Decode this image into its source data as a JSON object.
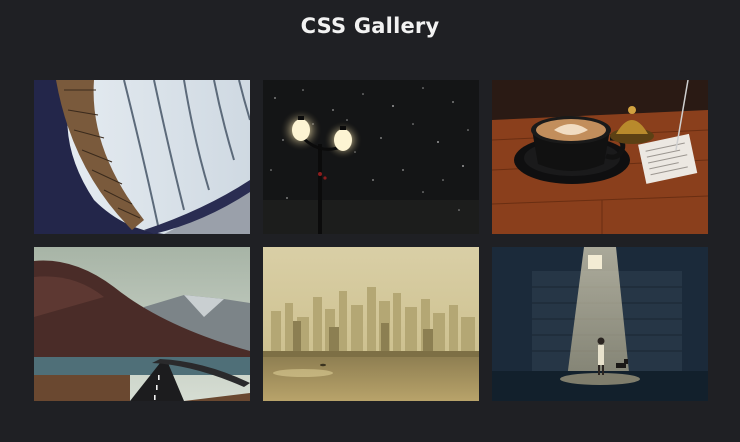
{
  "page": {
    "title": "CSS Gallery"
  },
  "gallery": {
    "images": [
      {
        "subject": "library-architecture"
      },
      {
        "subject": "streetlamp-in-snow"
      },
      {
        "subject": "latte-coffee-cup"
      },
      {
        "subject": "mountain-road-landscape"
      },
      {
        "subject": "hazy-city-skyline"
      },
      {
        "subject": "person-in-light-beam"
      }
    ]
  },
  "colors": {
    "background": "#1f2024",
    "title": "#f2f2f2"
  }
}
